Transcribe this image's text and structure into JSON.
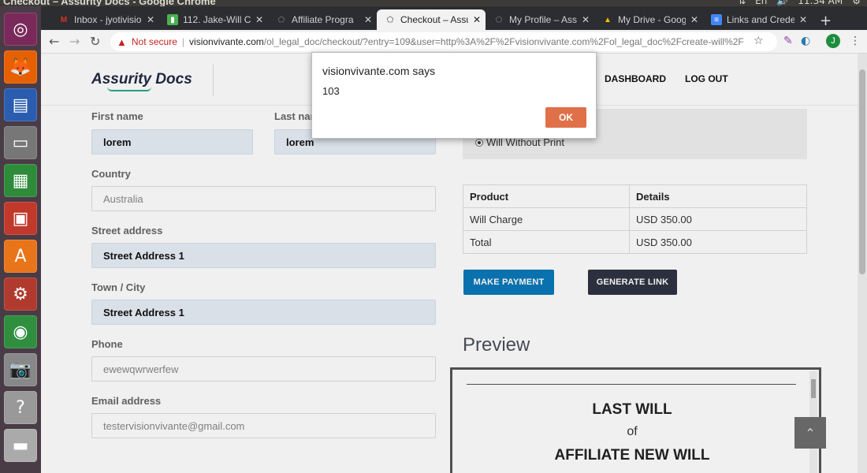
{
  "os": {
    "window_title": "Checkout – Assurity Docs - Google Chrome",
    "keyboard": "En",
    "clock": "11:34 AM"
  },
  "tabs": [
    {
      "label": "Inbox - jyotivisio",
      "icon": "gmail-icon",
      "color": "#d93025"
    },
    {
      "label": "112. Jake-Will Ch",
      "icon": "trello-icon",
      "color": "#4caf50"
    },
    {
      "label": "Affiliate Progra",
      "icon": "site-icon",
      "color": "#555555"
    },
    {
      "label": "Checkout – Assu",
      "icon": "site-icon",
      "color": "#555555"
    },
    {
      "label": "My Profile – Ass",
      "icon": "site-icon",
      "color": "#555555"
    },
    {
      "label": "My Drive - Goog",
      "icon": "drive-icon",
      "color": "#fbbc04"
    },
    {
      "label": "Links and Crede",
      "icon": "docs-icon",
      "color": "#4285f4"
    }
  ],
  "address": {
    "not_secure": "Not secure",
    "host": "visionvivante.com",
    "path": "/ol_legal_doc/checkout/?entry=109&user=http%3A%2F%2Fvisionvivante.com%2Fol_legal_doc%2Fcreate-will%2F",
    "profile_initial": "J"
  },
  "site": {
    "logo": "Assurity Docs",
    "nav": {
      "dashboard": "DASHBOARD",
      "logout": "LOG OUT"
    }
  },
  "form": {
    "first_name_label": "First name",
    "first_name_value": "lorem",
    "last_name_label": "Last nam",
    "last_name_value": "lorem",
    "country_label": "Country",
    "country_value": "Australia",
    "street_label": "Street address",
    "street_value": "Street Address 1",
    "town_label": "Town / City",
    "town_value": "Street Address 1",
    "phone_label": "Phone",
    "phone_value": "ewewqwrwerfew",
    "email_label": "Email address",
    "email_value": "testervisionvivante@gmail.com"
  },
  "option": {
    "label": "Will Without Print"
  },
  "order_table": {
    "headers": [
      "Product",
      "Details"
    ],
    "rows": [
      [
        "Will Charge",
        "USD  350.00"
      ],
      [
        "Total",
        "USD  350.00"
      ]
    ]
  },
  "buttons": {
    "make_payment": "MAKE PAYMENT",
    "generate_link": "GENERATE LINK"
  },
  "preview": {
    "heading": "Preview",
    "doc_title": "LAST WILL",
    "doc_of": "of",
    "doc_name": "AFFILIATE NEW WILL"
  },
  "alert": {
    "title": "visionvivante.com says",
    "message": "103",
    "ok": "OK"
  },
  "colors": {
    "primary_button": "#0a79b8",
    "dark_button": "#2f3342",
    "alert_ok": "#e07048"
  }
}
